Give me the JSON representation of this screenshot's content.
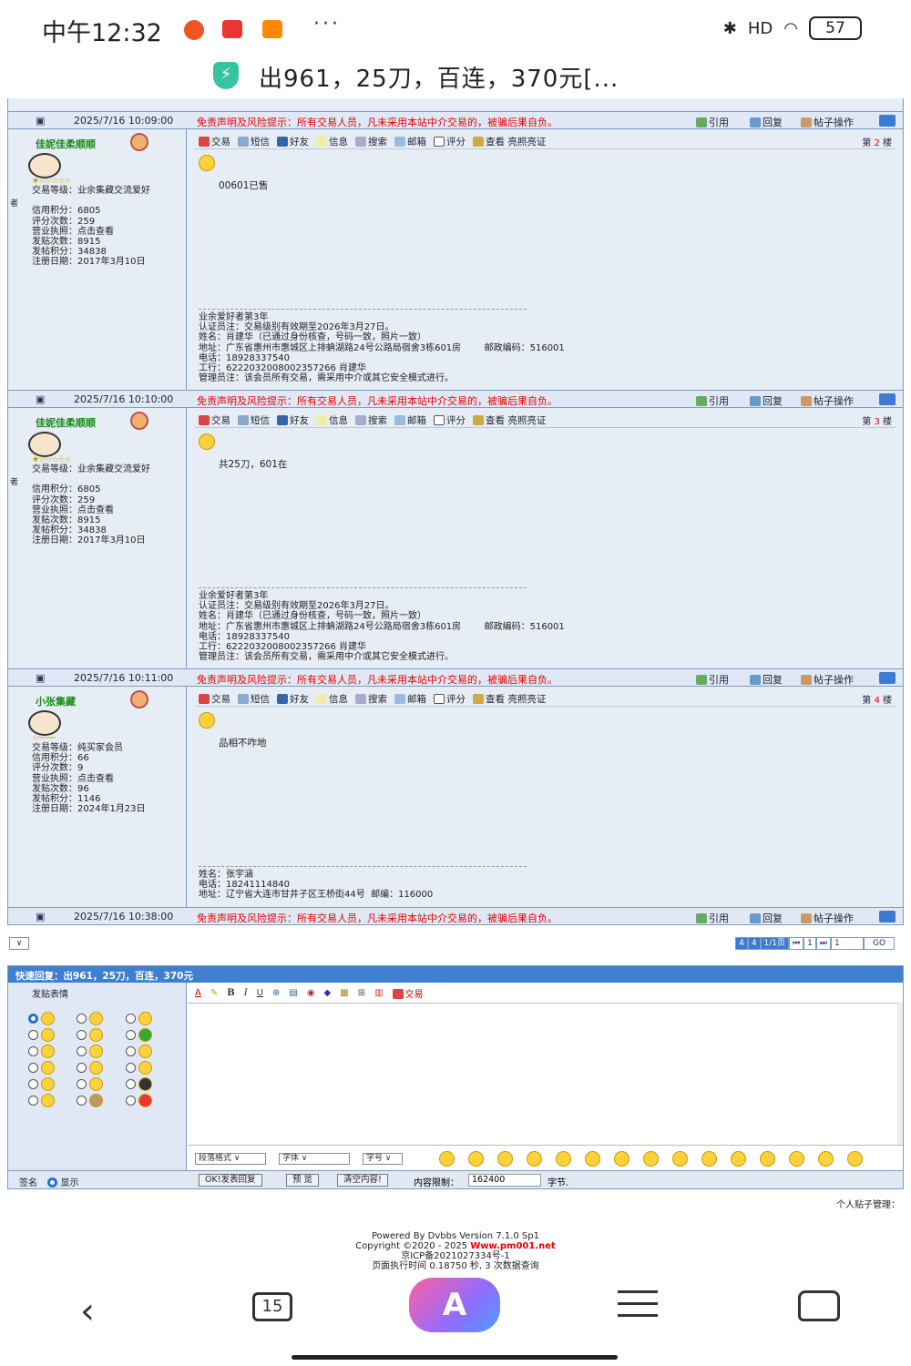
{
  "status": {
    "time": "中午12:32",
    "dots": "···",
    "signal": "HD",
    "battery": "57"
  },
  "browser": {
    "title": "出961，25刀，百连，370元[..."
  },
  "footers": [
    {
      "time": "2025/7/16 10:09:00"
    },
    {
      "time": "2025/7/16 10:10:00"
    },
    {
      "time": "2025/7/16 10:11:00"
    },
    {
      "time": "2025/7/16 10:38:00"
    }
  ],
  "disclaimer": "免责声明及风险提示：所有交易人员，凡未采用本站中介交易的，被骗后果自负。",
  "actions": {
    "quote": "引用",
    "reply": "回复",
    "ops": "帖子操作"
  },
  "toolbar": {
    "trade": "交易",
    "sms": "短信",
    "friend": "好友",
    "info": "信息",
    "search": "搜索",
    "mail": "邮箱",
    "rate": "评分",
    "view": "查看 亮照亮证"
  },
  "posts": [
    {
      "user": "佳妮佳柔顺顺",
      "side": "者",
      "info": "交易等级：业余集藏交流爱好\n\n信用积分：6805\n评分次数：259\n营业执照：点击查看\n发贴次数：8915\n发帖积分：34838\n注册日期：2017年3月10日",
      "floor_prefix": "第",
      "floor": "2",
      "floor_suffix": "楼",
      "content": "00601已售",
      "sig": "业余爱好者第3年\n认证员注：交易级别有效期至2026年3月27日。\n姓名：肖建华（已通过身份核查，号码一致，照片一致）\n地址：广东省惠州市惠城区上排蚺湖路24号公路局宿舍3栋601房        邮政编码：516001\n电话：18928337540\n工行：6222032008002357266 肖建华\n管理员注：该会员所有交易，需采用中介或其它安全模式进行。"
    },
    {
      "user": "佳妮佳柔顺顺",
      "side": "者",
      "info": "交易等级：业余集藏交流爱好\n\n信用积分：6805\n评分次数：259\n营业执照：点击查看\n发贴次数：8915\n发帖积分：34838\n注册日期：2017年3月10日",
      "floor_prefix": "第",
      "floor": "3",
      "floor_suffix": "楼",
      "content": "共25刀，601在",
      "sig": "业余爱好者第3年\n认证员注：交易级别有效期至2026年3月27日。\n姓名：肖建华（已通过身份核查，号码一致，照片一致）\n地址：广东省惠州市惠城区上排蚺湖路24号公路局宿舍3栋601房        邮政编码：516001\n电话：18928337540\n工行：6222032008002357266 肖建华\n管理员注：该会员所有交易，需采用中介或其它安全模式进行。"
    },
    {
      "user": "小张集藏",
      "side": "",
      "info": "交易等级：纯买家会员\n信用积分：66\n评分次数：9\n营业执照：点击查看\n发贴次数：96\n发帖积分：1146\n注册日期：2024年1月23日",
      "floor_prefix": "第",
      "floor": "4",
      "floor_suffix": "楼",
      "content": "品相不咋地",
      "sig": "姓名：张宇涵\n电话：18241114840\n地址：辽宁省大连市甘井子区王桥街44号  邮编：116000"
    }
  ],
  "pager": {
    "a": "4",
    "b": "4",
    "pages": "1/1页",
    "first": "⏮",
    "cur": "1",
    "last": "⏭",
    "input": "1",
    "go": "GO"
  },
  "quick_reply": {
    "title": "快速回复：出961，25刀，百连，370元",
    "emotion_header": "发贴表情",
    "selects": {
      "para": "段落格式",
      "font": "字体",
      "size": "字号"
    },
    "sign_label": "签名",
    "show_label": "显示",
    "submit": "OK!发表回复",
    "preview": "预 览",
    "clear": "清空内容!",
    "limit_label": "内容限制：",
    "limit_value": "162400",
    "limit_unit": "字节.",
    "trade_tool": "交易"
  },
  "manage": "个人贴子管理：",
  "footer": {
    "powered": "Powered By Dvbbs Version 7.1.0 Sp1",
    "copyright": "Copyright ©2020 - 2025",
    "site": "Www.pm001.net",
    "icp": "京ICP备2021027334号-1",
    "exec": "页面执行时间 0.18750 秒, 3 次数据查询"
  },
  "nav": {
    "tabs": "15"
  }
}
